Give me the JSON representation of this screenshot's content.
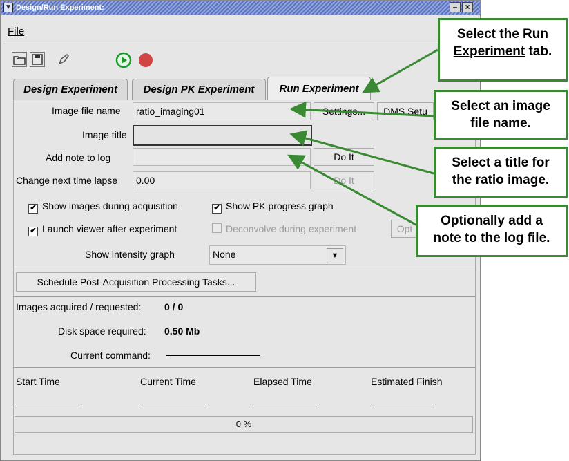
{
  "window": {
    "title": "Design/Run Experiment:",
    "minimize_glyph": "–",
    "close_glyph": "×"
  },
  "menu": {
    "file": "File"
  },
  "toolbar": {
    "icons": [
      "open-folder-icon",
      "save-disk-icon",
      "edit-pencil-icon",
      "play-icon",
      "record-stop-icon"
    ],
    "colors": {
      "play": "#1a9a2a",
      "record": "#d04444"
    }
  },
  "tabs": [
    {
      "label": "Design Experiment",
      "active": false
    },
    {
      "label": "Design PK Experiment",
      "active": false
    },
    {
      "label": "Run Experiment",
      "active": true
    }
  ],
  "form": {
    "image_file_name_label": "Image file name",
    "image_file_name_value": "ratio_imaging01",
    "settings_button": "Settings...",
    "dms_button": "DMS Setu",
    "image_title_label": "Image title",
    "image_title_value": "",
    "add_note_label": "Add note to log",
    "add_note_value": "",
    "do_it_button": "Do It",
    "time_lapse_label": "Change next time lapse",
    "time_lapse_value": "0.00",
    "do_it_button_2": "Do It"
  },
  "options": {
    "show_images": {
      "label": "Show images during acquisition",
      "checked": true
    },
    "show_pk": {
      "label": "Show PK progress graph",
      "checked": true
    },
    "launch_viewer": {
      "label": "Launch viewer after experiment",
      "checked": true
    },
    "deconvolve": {
      "label": "Deconvolve during experiment",
      "checked": false,
      "disabled": true
    },
    "options_button": "Opt",
    "intensity_label": "Show intensity graph",
    "intensity_value": "None"
  },
  "schedule_button": "Schedule Post-Acquisition Processing Tasks...",
  "status": {
    "images_label": "Images acquired / requested:",
    "images_value": "0 / 0",
    "disk_label": "Disk space required:",
    "disk_value": "0.50 Mb",
    "command_label": "Current command:"
  },
  "times": {
    "start": "Start Time",
    "current": "Current Time",
    "elapsed": "Elapsed Time",
    "finish": "Estimated Finish"
  },
  "progress": {
    "percent": 0,
    "text": "0 %"
  },
  "callouts": {
    "c1_line1": "Select the",
    "c1_run": "Run",
    "c1_experiment": "Experiment",
    "c1_tab": " tab.",
    "c2_line1": "Select an image",
    "c2_line2": "file name.",
    "c3_line1": "Select a title for",
    "c3_line2": "the ratio image.",
    "c4_line1": "Optionally add a",
    "c4_line2": "note to the log file.",
    "color": "#3a8a33"
  }
}
